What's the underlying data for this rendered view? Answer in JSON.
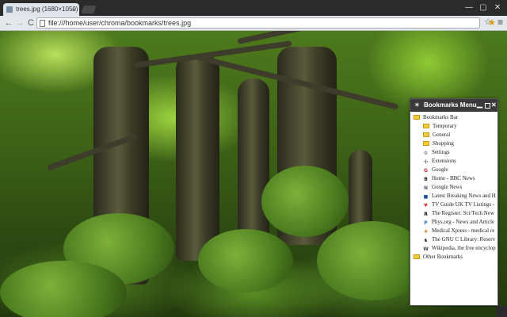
{
  "tab": {
    "title": "trees.jpg (1680×1050)",
    "close": "×"
  },
  "window": {
    "minimize": "—",
    "maximize": "▢",
    "close": "✕"
  },
  "toolbar": {
    "back": "←",
    "forward": "→",
    "reload": "C",
    "url": "file:///home/user/chroma/bookmarks/trees.jpg",
    "star": "☆",
    "menu": "≡"
  },
  "bookmarks_panel": {
    "title": "Bookmarks Menu",
    "pin": "✶",
    "min": "▁",
    "close": "✕",
    "bookmarks_bar": "Bookmarks Bar",
    "items": [
      {
        "label": "Temporary",
        "icon": "folder"
      },
      {
        "label": "General",
        "icon": "folder"
      },
      {
        "label": "Shopping",
        "icon": "folder"
      },
      {
        "label": "Settings",
        "icon": "gear-icon",
        "glyph": "⚙"
      },
      {
        "label": "Extensions",
        "icon": "puzzle-icon",
        "glyph": "✣"
      },
      {
        "label": "Google",
        "icon": "google-icon",
        "glyph": "G"
      },
      {
        "label": "Home - BBC News",
        "icon": "bbc-icon",
        "glyph": "B"
      },
      {
        "label": "Google News",
        "icon": "news-icon",
        "glyph": "N"
      },
      {
        "label": "Latest Breaking News and H",
        "icon": "breaking-news-icon",
        "glyph": "■"
      },
      {
        "label": "TV Guide UK TV Listings -",
        "icon": "heart-icon",
        "glyph": "♥"
      },
      {
        "label": "The Register: Sci/Tech New",
        "icon": "register-icon",
        "glyph": "R"
      },
      {
        "label": "Phys.org - News and Article",
        "icon": "phys-icon",
        "glyph": "P"
      },
      {
        "label": "Medical Xpress - medical re",
        "icon": "medical-icon",
        "glyph": "✚"
      },
      {
        "label": "The GNU C Library: Reserv",
        "icon": "gnu-icon",
        "glyph": "♞"
      },
      {
        "label": "Wikipedia, the free encyclop",
        "icon": "wikipedia-icon",
        "glyph": "W"
      }
    ],
    "other_bookmarks": "Other Bookmarks"
  }
}
